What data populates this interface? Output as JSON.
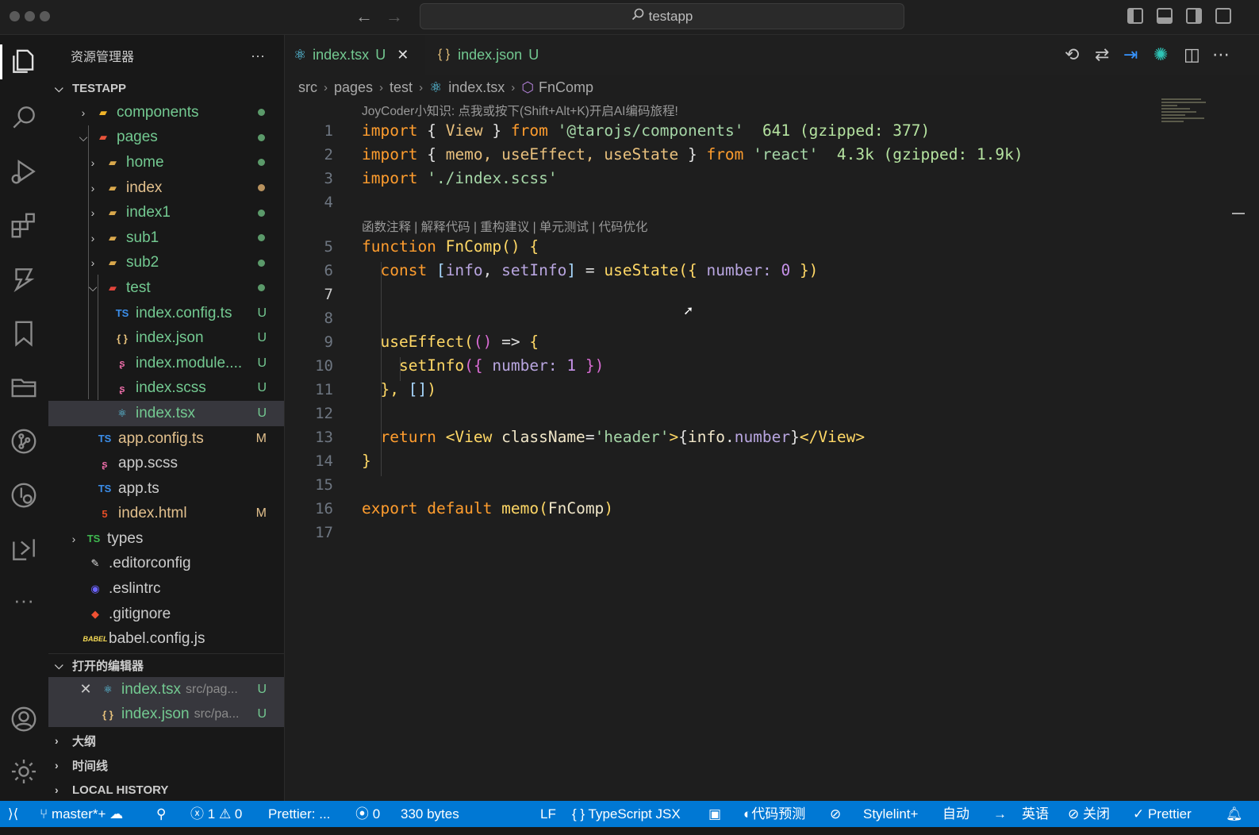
{
  "titlebar": {
    "search_text": "testapp"
  },
  "sidebar": {
    "title": "资源管理器",
    "more": "···",
    "project": "TESTAPP",
    "tree": [
      {
        "name": "components",
        "status": "",
        "kind": "folder"
      },
      {
        "name": "pages",
        "status": "",
        "kind": "folder"
      },
      {
        "name": "home",
        "status": "",
        "kind": "folder"
      },
      {
        "name": "index",
        "status": "",
        "kind": "folder"
      },
      {
        "name": "index1",
        "status": "",
        "kind": "folder"
      },
      {
        "name": "sub1",
        "status": "",
        "kind": "folder"
      },
      {
        "name": "sub2",
        "status": "",
        "kind": "folder"
      },
      {
        "name": "test",
        "status": "",
        "kind": "folder"
      },
      {
        "name": "index.config.ts",
        "status": "U",
        "kind": "ts"
      },
      {
        "name": "index.json",
        "status": "U",
        "kind": "json"
      },
      {
        "name": "index.module....",
        "status": "U",
        "kind": "scss"
      },
      {
        "name": "index.scss",
        "status": "U",
        "kind": "scss"
      },
      {
        "name": "index.tsx",
        "status": "U",
        "kind": "react"
      },
      {
        "name": "app.config.ts",
        "status": "M",
        "kind": "ts"
      },
      {
        "name": "app.scss",
        "status": "",
        "kind": "scss"
      },
      {
        "name": "app.ts",
        "status": "",
        "kind": "ts"
      },
      {
        "name": "index.html",
        "status": "M",
        "kind": "html"
      },
      {
        "name": "types",
        "status": "",
        "kind": "folder"
      },
      {
        "name": ".editorconfig",
        "status": "",
        "kind": "file"
      },
      {
        "name": ".eslintrc",
        "status": "",
        "kind": "file"
      },
      {
        "name": ".gitignore",
        "status": "",
        "kind": "file"
      },
      {
        "name": "babel.config.js",
        "status": "",
        "kind": "file"
      }
    ],
    "open_editors_title": "打开的编辑器",
    "open_editors": [
      {
        "name": "index.tsx",
        "path": "src/pag...",
        "status": "U"
      },
      {
        "name": "index.json",
        "path": "src/pa...",
        "status": "U"
      }
    ],
    "outline_title": "大纲",
    "timeline_title": "时间线",
    "local_history_title": "LOCAL HISTORY"
  },
  "tabs": [
    {
      "label": "index.tsx",
      "status": "U",
      "active": true
    },
    {
      "label": "index.json",
      "status": "U",
      "active": false
    }
  ],
  "breadcrumb": [
    "src",
    "pages",
    "test",
    "index.tsx",
    "FnComp"
  ],
  "editor": {
    "codelens_top": "JoyCoder小知识: 点我或按下(Shift+Alt+K)开启AI编码旅程!",
    "codelens_fn": "函数注释 | 解释代码 | 重构建议 | 单元测试 | 代码优化",
    "line_numbers": [
      "1",
      "2",
      "3",
      "4",
      "5",
      "6",
      "7",
      "8",
      "9",
      "10",
      "11",
      "12",
      "13",
      "14",
      "15",
      "16",
      "17"
    ],
    "line1": {
      "import": "import",
      "lb": "{",
      "view": "View",
      "rb": "}",
      "from": "from",
      "module": "'@tarojs/components'",
      "size": "641 (gzipped: 377)"
    },
    "line2": {
      "import": "import",
      "lb": "{",
      "names": "memo, useEffect, useState",
      "rb": "}",
      "from": "from",
      "module": "'react'",
      "size": "4.3k (gzipped: 1.9k)"
    },
    "line3": {
      "import": "import",
      "module": "'./index.scss'"
    },
    "line5": {
      "function": "function",
      "name": "FnComp",
      "parens": "()",
      "brace": "{"
    },
    "line6": {
      "const": "const",
      "lb": "[",
      "a": "info",
      "comma": ",",
      "b": "setInfo",
      "rb": "]",
      "eq": "=",
      "call": "useState",
      "open": "({",
      "prop": "number:",
      "val": "0",
      "close": "})"
    },
    "line9": {
      "call": "useEffect",
      "open": "(",
      "parens": "()",
      "arrow": "=>",
      "brace": "{"
    },
    "line10": {
      "call": "setInfo",
      "open": "({",
      "prop": "number:",
      "val": "1",
      "close": "})"
    },
    "line11": {
      "close": "},",
      "arr": "[]",
      "paren": ")"
    },
    "line13": {
      "return": "return",
      "open_tag": "<View",
      "attr": "className",
      "eq": "=",
      "value": "'header'",
      "gt": ">",
      "expr_open": "{",
      "obj": "info",
      "dot": ".",
      "prop": "number",
      "expr_close": "}",
      "close_tag": "</View>"
    },
    "line14": "}",
    "line16": {
      "export": "export",
      "default": "default",
      "call": "memo",
      "open": "(",
      "arg": "FnComp",
      "close": ")"
    }
  },
  "statusbar": {
    "branch": "master*+",
    "errors": "1",
    "warnings": "0",
    "prettier_short": "Prettier: ...",
    "ports": "0",
    "size": "330 bytes",
    "eol": "LF",
    "language": "TypeScript JSX",
    "prediction": "代码预测",
    "stylelint": "Stylelint+",
    "auto": "自动",
    "lang": "英语",
    "close": "关闭",
    "prettier": "Prettier"
  },
  "colors": {
    "accent": "#0078d4",
    "untracked": "#73c991",
    "modified": "#e2c08d",
    "keyword": "#ff9d2e",
    "function": "#ffd866"
  }
}
